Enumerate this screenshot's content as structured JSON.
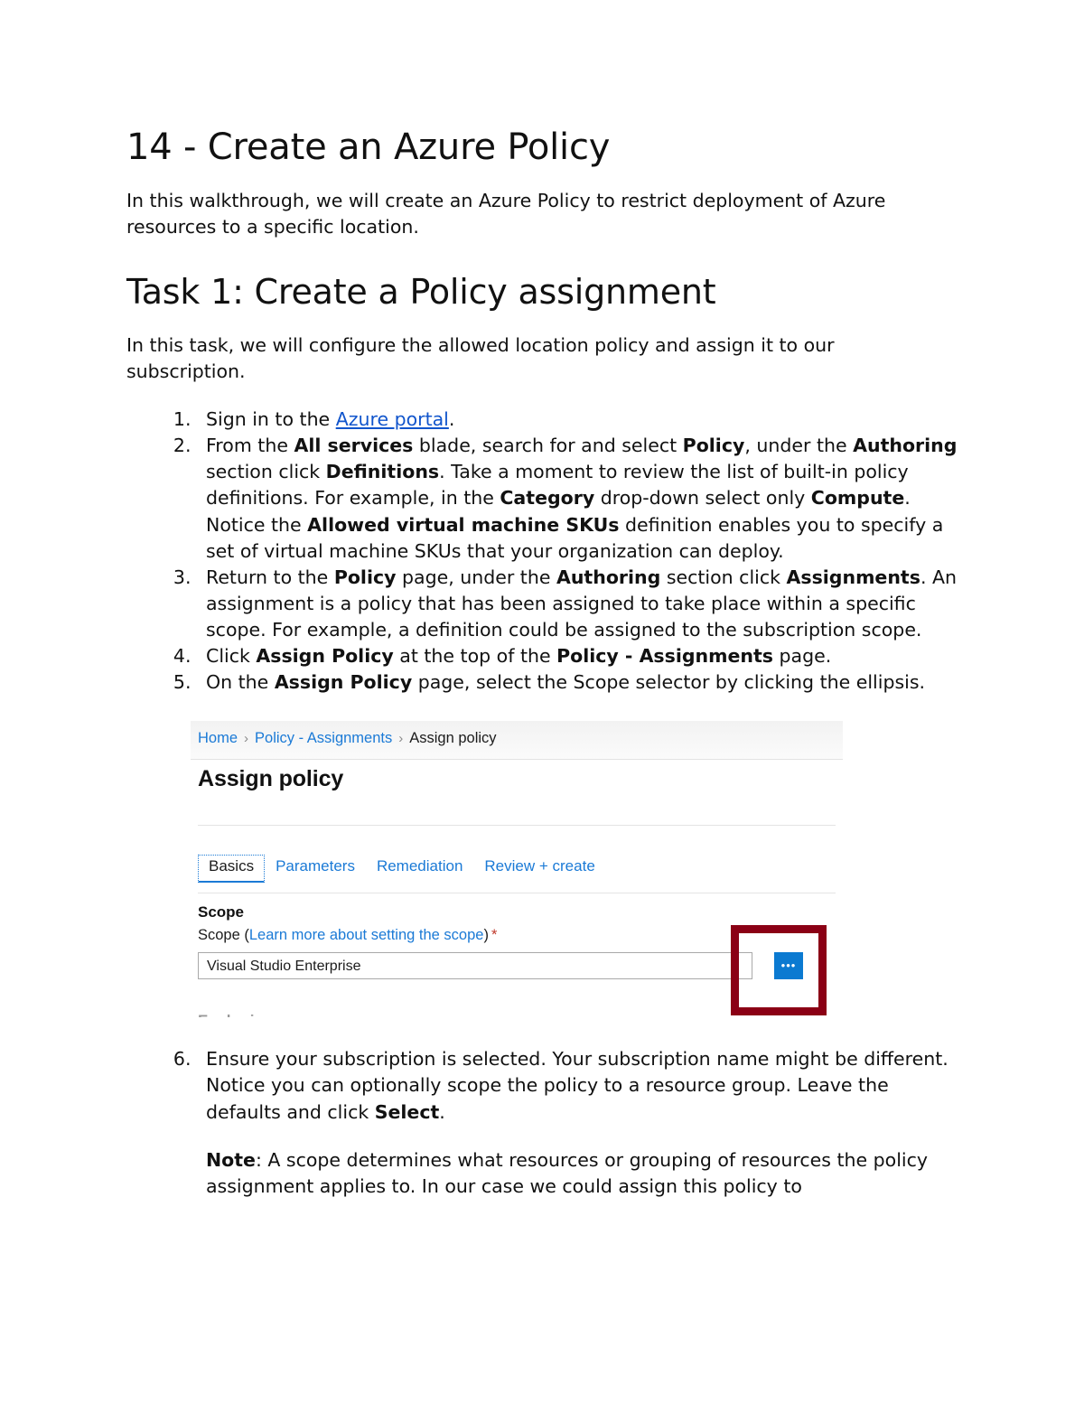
{
  "document": {
    "title": "14 - Create an Azure Policy",
    "intro": "In this walkthrough, we will create an Azure Policy to restrict deployment of Azure resources to a specific location.",
    "section_heading": "Task 1: Create a Policy assignment",
    "section_intro": "In this task, we will configure the allowed location policy and assign it to our subscription."
  },
  "steps": {
    "s1": {
      "pre": "Sign in to the ",
      "link": "Azure portal",
      "post": "."
    },
    "s2": {
      "t1": "From the ",
      "b1": "All services",
      "t2": " blade, search for and select ",
      "b2": "Policy",
      "t3": ", under the ",
      "b3": "Authoring",
      "t4": " section click ",
      "b4": "Definitions",
      "t5": ". Take a moment to review the list of built-in policy definitions. For example, in the ",
      "b5": "Category",
      "t6": " drop-down select only ",
      "b6": "Compute",
      "t7": ". Notice the ",
      "b7": "Allowed virtual machine SKUs",
      "t8": " definition enables you to specify a set of virtual machine SKUs that your organization can deploy."
    },
    "s3": {
      "t1": "Return to the ",
      "b1": "Policy",
      "t2": " page, under the ",
      "b2": "Authoring",
      "t3": " section click ",
      "b3": "Assignments",
      "t4": ". An assignment is a policy that has been assigned to take place within a specific scope. For example, a definition could be assigned to the subscription scope."
    },
    "s4": {
      "t1": "Click ",
      "b1": "Assign Policy",
      "t2": " at the top of the ",
      "b2": "Policy - Assignments",
      "t3": " page."
    },
    "s5": {
      "t1": "On the ",
      "b1": "Assign Policy",
      "t2": " page, select the Scope selector by clicking the ellipsis."
    },
    "s6": {
      "t1": "Ensure your subscription is selected. Your subscription name might be different. Notice you can optionally scope the policy to a resource group. Leave the defaults and click ",
      "b1": "Select",
      "t2": "."
    }
  },
  "note": {
    "label": "Note",
    "text": ": A scope determines what resources or grouping of resources the policy assignment applies to. In our case we could assign this policy to"
  },
  "screenshot": {
    "breadcrumb": {
      "home": "Home",
      "separator": "›",
      "policy_assignments": "Policy - Assignments",
      "current": "Assign policy"
    },
    "title": "Assign policy",
    "tabs": [
      {
        "label": "Basics",
        "active": true
      },
      {
        "label": "Parameters",
        "active": false
      },
      {
        "label": "Remediation",
        "active": false
      },
      {
        "label": "Review + create",
        "active": false
      }
    ],
    "scope": {
      "heading": "Scope",
      "label_pre": "Scope (",
      "label_link": "Learn more about setting the scope",
      "label_post": ")",
      "required_marker": "*",
      "input_value": "Visual Studio Enterprise",
      "ellipsis_button_label": "•••"
    },
    "cut_off_text": "Exclusions",
    "colors": {
      "azure_blue": "#0b7ad1",
      "link_blue": "#1b7ad6",
      "annotation_red": "#8b0015",
      "required_red": "#c0392b",
      "doc_link_blue": "#1155cc"
    }
  }
}
